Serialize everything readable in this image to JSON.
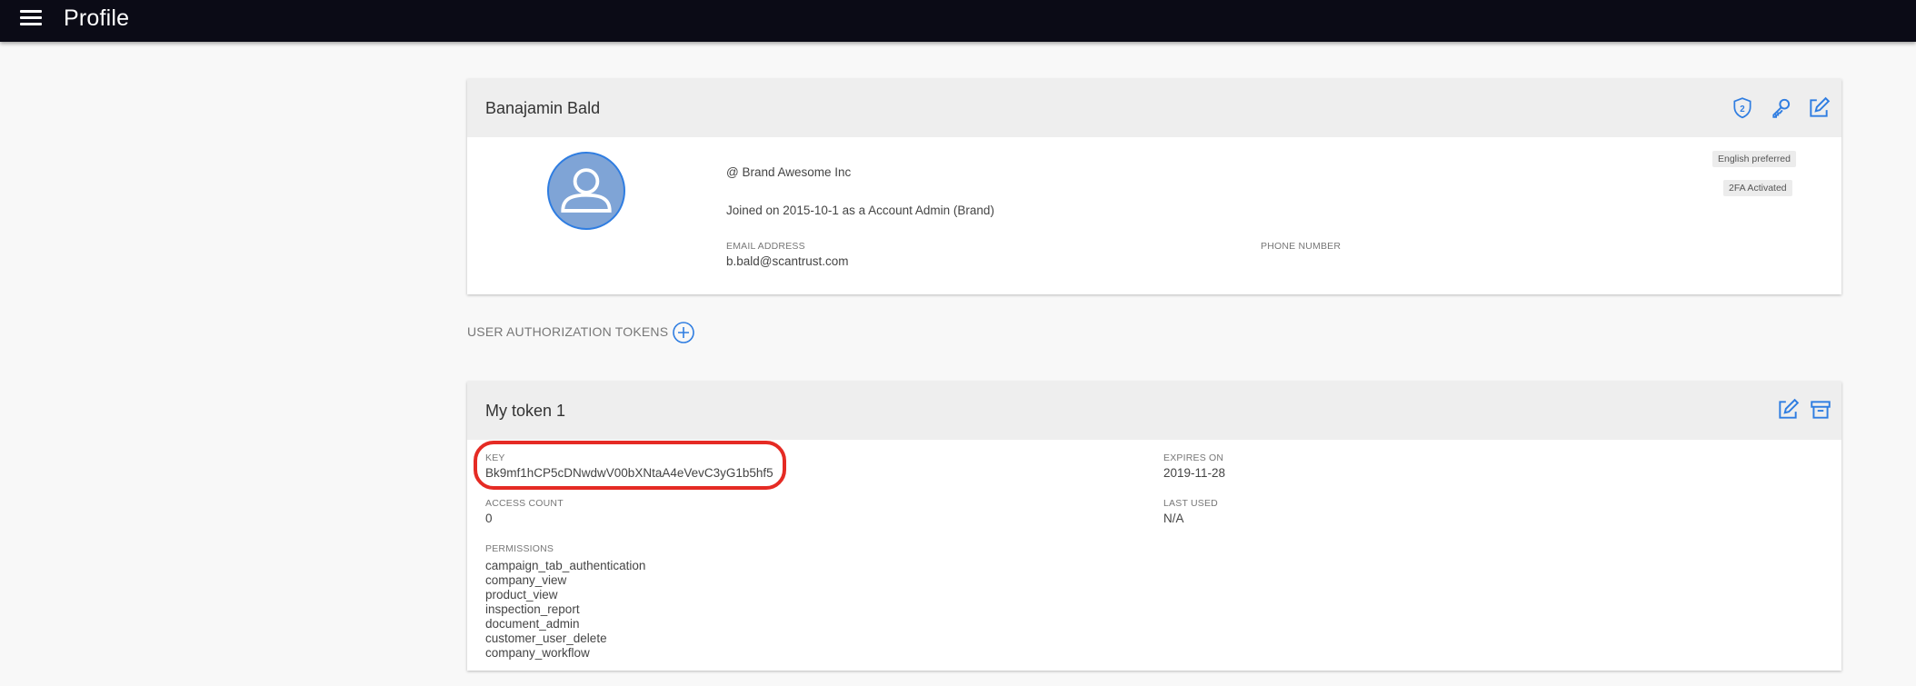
{
  "app": {
    "title": "Profile"
  },
  "profile": {
    "name": "Banajamin Bald",
    "company": "@ Brand Awesome Inc",
    "joined": "Joined on 2015-10-1 as a Account Admin (Brand)",
    "email_label": "EMAIL ADDRESS",
    "email": "b.bald@scantrust.com",
    "phone_label": "PHONE NUMBER",
    "phone": "",
    "chips": [
      "English preferred",
      "2FA Activated"
    ],
    "icons": [
      "two-factor-shield-icon",
      "key-icon",
      "edit-icon"
    ]
  },
  "tokens_section": {
    "heading": "USER AUTHORIZATION TOKENS",
    "add_icon": "add-circle-icon"
  },
  "token": {
    "name": "My token 1",
    "key_label": "KEY",
    "key": "Bk9mf1hCP5cDNwdwV00bXNtaA4eVevC3yG1b5hf5",
    "expires_label": "EXPIRES ON",
    "expires": "2019-11-28",
    "access_label": "ACCESS COUNT",
    "access_count": "0",
    "last_used_label": "LAST USED",
    "last_used": "N/A",
    "permissions_label": "PERMISSIONS",
    "permissions": [
      "campaign_tab_authentication",
      "company_view",
      "product_view",
      "inspection_report",
      "document_admin",
      "customer_user_delete",
      "company_workflow"
    ],
    "icons": [
      "edit-icon",
      "archive-icon"
    ]
  },
  "colors": {
    "topbar": "#0b0b16",
    "accent": "#2f7de1",
    "highlight": "#e52b24",
    "avatar": "#7fa4d6"
  }
}
